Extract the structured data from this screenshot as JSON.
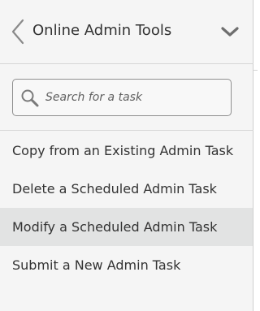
{
  "header": {
    "title": "Online Admin Tools",
    "back_icon": "chevron-left-icon",
    "collapse_icon": "chevron-down-icon"
  },
  "search": {
    "placeholder": "Search for a task",
    "value": "",
    "icon": "search-icon"
  },
  "tasks": [
    {
      "label": "Copy from an Existing Admin Task",
      "selected": false
    },
    {
      "label": "Delete a Scheduled Admin Task",
      "selected": false
    },
    {
      "label": "Modify a Scheduled Admin Task",
      "selected": true
    },
    {
      "label": "Submit a New Admin Task",
      "selected": false
    }
  ],
  "colors": {
    "panel_background": "#f5f5f5",
    "selected_row": "#e2e3e3",
    "text": "#333333",
    "icon": "#7a7a7a"
  }
}
